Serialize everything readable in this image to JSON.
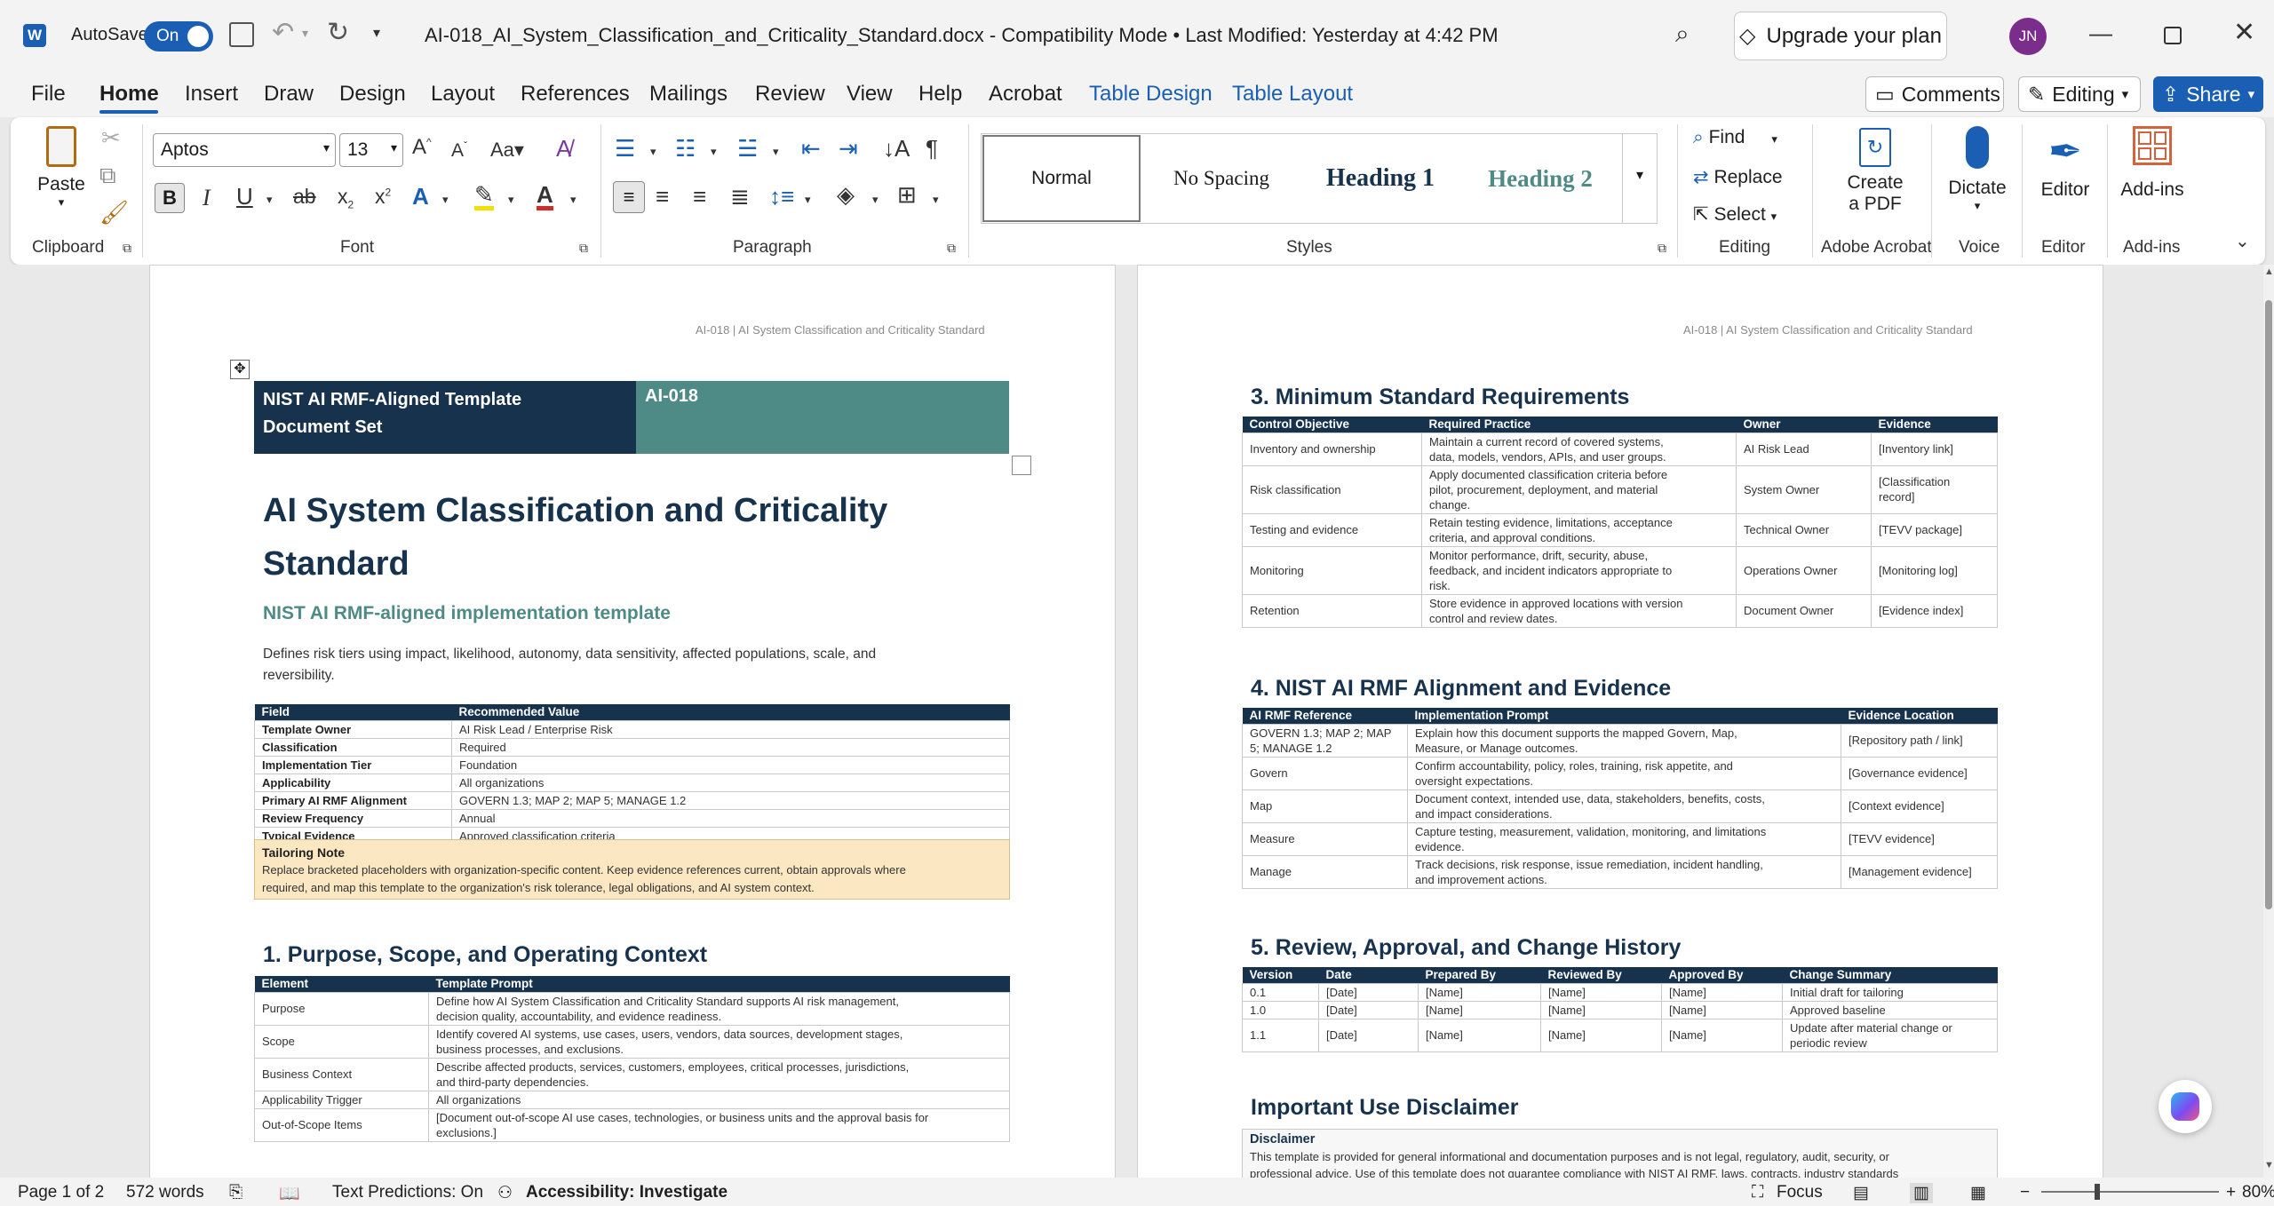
{
  "titlebar": {
    "autosave_label": "AutoSave",
    "autosave_state": "On",
    "doc_title": "AI-018_AI_System_Classification_and_Criticality_Standard.docx  -  Compatibility Mode  •  Last Modified: Yesterday at 4:42 PM",
    "upgrade_label": "Upgrade your plan",
    "avatar_initials": "JN"
  },
  "tabs": [
    "File",
    "Home",
    "Insert",
    "Draw",
    "Design",
    "Layout",
    "References",
    "Mailings",
    "Review",
    "View",
    "Help",
    "Acrobat",
    "Table Design",
    "Table Layout"
  ],
  "actions": {
    "comments": "Comments",
    "editing": "Editing",
    "share": "Share"
  },
  "ribbon": {
    "clipboard": {
      "paste": "Paste",
      "label": "Clipboard"
    },
    "font": {
      "name": "Aptos",
      "size": "13",
      "label": "Font"
    },
    "paragraph": {
      "label": "Paragraph"
    },
    "styles": {
      "items": [
        "Normal",
        "No Spacing",
        "Heading 1",
        "Heading 2"
      ],
      "label": "Styles"
    },
    "editing": {
      "find": "Find",
      "replace": "Replace",
      "select": "Select",
      "label": "Editing"
    },
    "acrobat": {
      "create1": "Create",
      "create2": "a PDF",
      "label": "Adobe Acrobat"
    },
    "voice": {
      "dictate": "Dictate",
      "label": "Voice"
    },
    "editor": {
      "button": "Editor",
      "label": "Editor"
    },
    "addins": {
      "button": "Add-ins",
      "label": "Add-ins"
    }
  },
  "page1": {
    "header": "AI-018 | AI System Classification and Criticality Standard",
    "banner_left_1": "NIST AI RMF-Aligned Template",
    "banner_left_2": "Document Set",
    "banner_right": "AI-018",
    "title_1": "AI System Classification and Criticality",
    "title_2": "Standard",
    "subtitle": "NIST AI RMF-aligned implementation template",
    "description_1": "Defines risk tiers using impact, likelihood, autonomy, data sensitivity, affected populations, scale, and",
    "description_2": "reversibility.",
    "meta_headers": [
      "Field",
      "Recommended Value"
    ],
    "meta_rows": [
      [
        "Template Owner",
        "AI Risk Lead / Enterprise Risk"
      ],
      [
        "Classification",
        "Required"
      ],
      [
        "Implementation Tier",
        "Foundation"
      ],
      [
        "Applicability",
        "All organizations"
      ],
      [
        "Primary AI RMF Alignment",
        "GOVERN 1.3; MAP 2; MAP 5; MANAGE 1.2"
      ],
      [
        "Review Frequency",
        "Annual"
      ],
      [
        "Typical Evidence",
        "Approved classification criteria"
      ]
    ],
    "tailoring_title": "Tailoring Note",
    "tailoring_1": "Replace bracketed placeholders with organization-specific content. Keep evidence references current, obtain approvals where",
    "tailoring_2": "required, and map this template to the organization's risk tolerance, legal obligations, and AI system context.",
    "section1": "1. Purpose, Scope, and Operating Context",
    "s1_headers": [
      "Element",
      "Template Prompt"
    ],
    "s1_rows": [
      [
        "Purpose",
        "Define how AI System Classification and Criticality Standard supports AI risk management,",
        "decision quality, accountability, and evidence readiness."
      ],
      [
        "Scope",
        "Identify covered AI systems, use cases, users, vendors, data sources, development stages,",
        "business processes, and exclusions."
      ],
      [
        "Business Context",
        "Describe affected products, services, customers, employees, critical processes, jurisdictions,",
        "and third-party dependencies."
      ],
      [
        "Applicability Trigger",
        "All organizations",
        ""
      ],
      [
        "Out-of-Scope Items",
        "[Document out-of-scope AI use cases, technologies, or business units and the approval basis for",
        "exclusions.]"
      ]
    ]
  },
  "page2": {
    "header": "AI-018 | AI System Classification and Criticality Standard",
    "section3": "3. Minimum Standard Requirements",
    "s3_headers": [
      "Control Objective",
      "Required Practice",
      "Owner",
      "Evidence"
    ],
    "s3_rows": [
      [
        "Inventory and ownership",
        "Maintain a current record of covered systems,",
        "data, models, vendors, APIs, and user groups.",
        "",
        "AI Risk Lead",
        "[Inventory link]",
        ""
      ],
      [
        "Risk classification",
        "Apply documented classification criteria before",
        "pilot, procurement, deployment, and material",
        "change.",
        "System Owner",
        "[Classification",
        "record]"
      ],
      [
        "Testing and evidence",
        "Retain testing evidence, limitations, acceptance",
        "criteria, and approval conditions.",
        "",
        "Technical Owner",
        "[TEVV package]",
        ""
      ],
      [
        "Monitoring",
        "Monitor performance, drift, security, abuse,",
        "feedback, and incident indicators appropriate to",
        "risk.",
        "Operations Owner",
        "[Monitoring log]",
        ""
      ],
      [
        "Retention",
        "Store evidence in approved locations with version",
        "control and review dates.",
        "",
        "Document Owner",
        "[Evidence index]",
        ""
      ]
    ],
    "section4": "4. NIST AI RMF Alignment and Evidence",
    "s4_headers": [
      "AI RMF Reference",
      "Implementation Prompt",
      "Evidence Location"
    ],
    "s4_rows": [
      [
        "GOVERN 1.3; MAP 2; MAP",
        "5; MANAGE 1.2",
        "Explain how this document supports the mapped Govern, Map,",
        "Measure, or Manage outcomes.",
        "[Repository path / link]"
      ],
      [
        "Govern",
        "",
        "Confirm accountability, policy, roles, training, risk appetite, and",
        "oversight expectations.",
        "[Governance evidence]"
      ],
      [
        "Map",
        "",
        "Document context, intended use, data, stakeholders, benefits, costs,",
        "and impact considerations.",
        "[Context evidence]"
      ],
      [
        "Measure",
        "",
        "Capture testing, measurement, validation, monitoring, and limitations",
        "evidence.",
        "[TEVV evidence]"
      ],
      [
        "Manage",
        "",
        "Track decisions, risk response, issue remediation, incident handling,",
        "and improvement actions.",
        "[Management evidence]"
      ]
    ],
    "section5": "5. Review, Approval, and Change History",
    "s5_headers": [
      "Version",
      "Date",
      "Prepared By",
      "Reviewed By",
      "Approved By",
      "Change Summary"
    ],
    "s5_rows": [
      [
        "0.1",
        "[Date]",
        "[Name]",
        "[Name]",
        "[Name]",
        "Initial draft for tailoring",
        ""
      ],
      [
        "1.0",
        "[Date]",
        "[Name]",
        "[Name]",
        "[Name]",
        "Approved baseline",
        ""
      ],
      [
        "1.1",
        "[Date]",
        "[Name]",
        "[Name]",
        "[Name]",
        "Update after material change or",
        "periodic review"
      ]
    ],
    "disclaimer_heading": "Important Use Disclaimer",
    "disclaimer_title": "Disclaimer",
    "disclaimer_1": "This template is provided for general informational and documentation purposes and is not legal, regulatory, audit, security, or",
    "disclaimer_2": "professional advice. Use of this template does not guarantee compliance with NIST AI RMF, laws, contracts, industry standards"
  },
  "status": {
    "page": "Page 1 of 2",
    "words": "572 words",
    "predictions": "Text Predictions: On",
    "accessibility": "Accessibility: Investigate",
    "focus": "Focus",
    "zoom": "80%"
  },
  "colors": {
    "navy": "#17324d",
    "teal": "#4e8a86",
    "accent": "#1a5fb4",
    "tailoring_bg": "#fbe7c2"
  }
}
